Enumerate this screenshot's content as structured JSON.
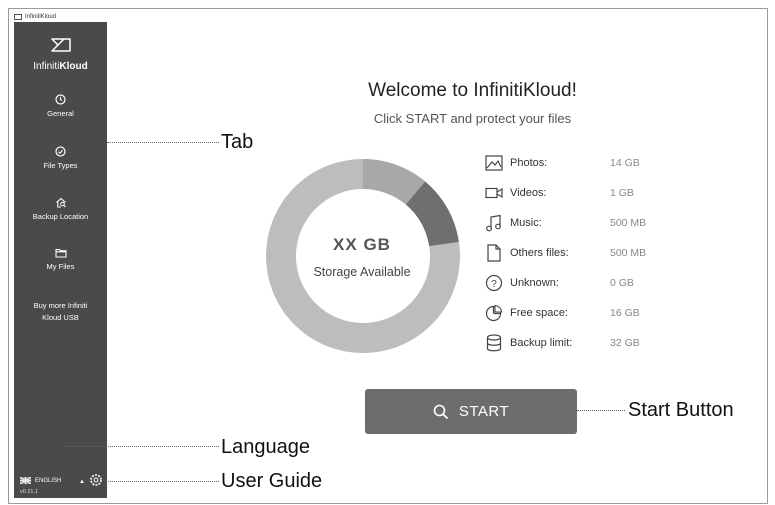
{
  "window": {
    "title": "InfinitiKloud"
  },
  "sidebar": {
    "logo_text_light": "Infiniti",
    "logo_text_bold": "Kloud",
    "items": [
      {
        "label": "General",
        "icon": "clock-icon"
      },
      {
        "label": "File Types",
        "icon": "check-circle-icon"
      },
      {
        "label": "Backup Location",
        "icon": "home-search-icon"
      },
      {
        "label": "My Files",
        "icon": "folder-icon"
      },
      {
        "label_line1": "Buy more Infiniti",
        "label_line2": "Kloud USB"
      }
    ],
    "language": "ENGLISH",
    "version": "v0.21.1"
  },
  "main": {
    "welcome": "Welcome to InfinitiKloud!",
    "subtitle": "Click START and protect your files",
    "storage_value": "XX GB",
    "storage_label": "Storage Available",
    "stats": [
      {
        "label": "Photos:",
        "value": "14 GB",
        "icon": "image-icon"
      },
      {
        "label": "Videos:",
        "value": "1 GB",
        "icon": "video-camera-icon"
      },
      {
        "label": "Music:",
        "value": "500 MB",
        "icon": "music-note-icon"
      },
      {
        "label": "Others files:",
        "value": "500 MB",
        "icon": "document-icon"
      },
      {
        "label": "Unknown:",
        "value": "0 GB",
        "icon": "question-circle-icon"
      },
      {
        "label": "Free space:",
        "value": "16 GB",
        "icon": "pie-icon"
      },
      {
        "label": "Backup limit:",
        "value": "32 GB",
        "icon": "database-icon"
      }
    ],
    "start_label": "START"
  },
  "callouts": {
    "tab": "Tab",
    "start_button": "Start Button",
    "language": "Language",
    "user_guide": "User Guide"
  },
  "colors": {
    "sidebar_bg": "#4a4a4a",
    "donut_light": "#bdbdbd",
    "donut_mid": "#a8a8a8",
    "donut_dark": "#6f6f6f",
    "button_bg": "#6d6d6d"
  }
}
